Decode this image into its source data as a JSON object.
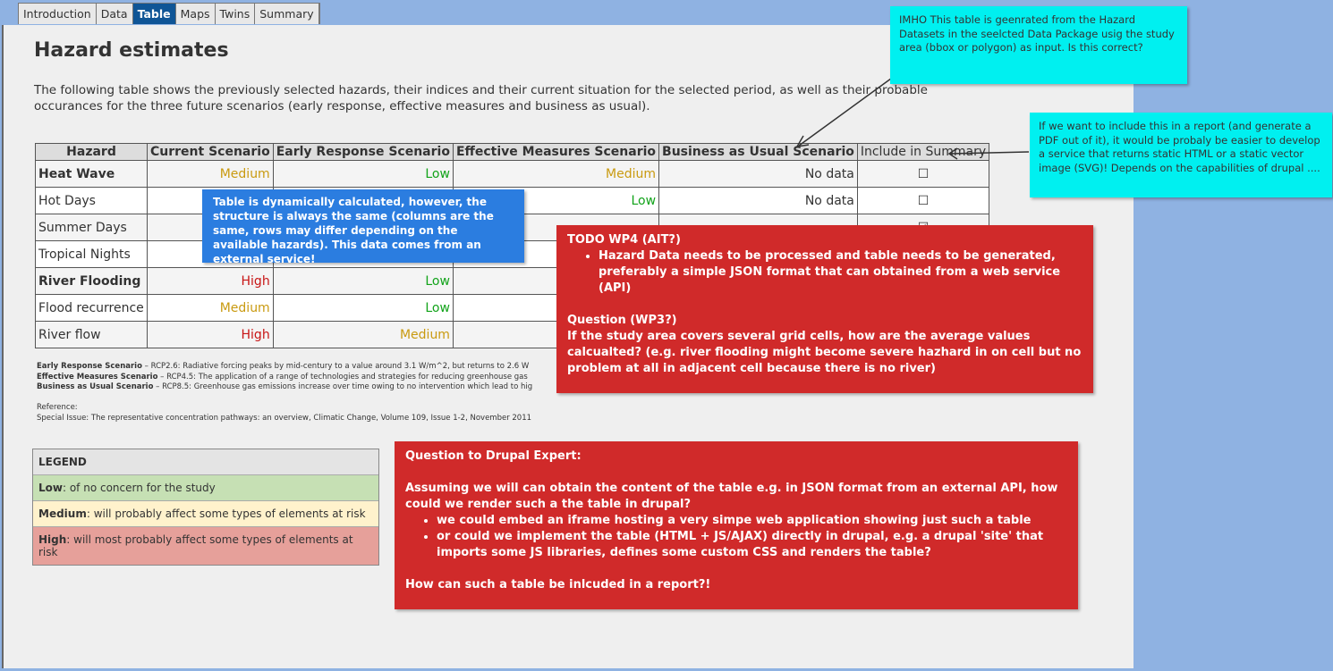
{
  "tabs": [
    "Introduction",
    "Data",
    "Table",
    "Maps",
    "Twins",
    "Summary"
  ],
  "active_tab": "Table",
  "title": "Hazard estimates",
  "intro": "The following table shows the previously selected hazards, their indices and their current situation for the selected period, as well as their probable occurances for the three future scenarios (early response, effective measures and business as usual).",
  "table": {
    "headers": [
      "Hazard",
      "Current Scenario",
      "Early Response Scenario",
      "Effective Measures Scenario",
      "Business as Usual Scenario",
      "Include in Summary"
    ],
    "rows": [
      {
        "hazard": "Heat Wave",
        "bold": true,
        "current": "Medium",
        "early": "Low",
        "effective": "Medium",
        "business": "No data",
        "include": false
      },
      {
        "hazard": "Hot Days",
        "bold": false,
        "current": "",
        "early": "",
        "effective": "Low",
        "business": "No data",
        "include": false
      },
      {
        "hazard": "Summer Days",
        "bold": false,
        "current": "",
        "early": "",
        "effective": "",
        "business": "",
        "include": true
      },
      {
        "hazard": "Tropical Nights",
        "bold": false,
        "current": "",
        "early": "",
        "effective": "",
        "business": "",
        "include": false
      },
      {
        "hazard": "River Flooding",
        "bold": true,
        "current": "High",
        "early": "Low",
        "effective": "",
        "business": "",
        "include": false
      },
      {
        "hazard": "Flood recurrence",
        "bold": false,
        "current": "Medium",
        "early": "Low",
        "effective": "",
        "business": "",
        "include": false
      },
      {
        "hazard": "River flow",
        "bold": false,
        "current": "High",
        "early": "Medium",
        "effective": "",
        "business": "",
        "include": false
      }
    ]
  },
  "footnotes": [
    {
      "label": "Early Response Scenario",
      "text": " – RCP2.6: Radiative forcing peaks by mid-century to a value around 3.1 W/m^2, but returns to 2.6 W"
    },
    {
      "label": "Effective Measures Scenario",
      "text": " – RCP4.5: The application of a range of technologies and strategies for reducing greenhouse gas"
    },
    {
      "label": "Business as Usual Scenario",
      "text": " – RCP8.5: Greenhouse gas emissions increase over time owing to no intervention which lead to hig"
    }
  ],
  "reference_label": "Reference:",
  "reference": "Special Issue: The representative concentration pathways: an overview, Climatic Change, Volume 109, Issue 1-2, November 2011",
  "legend": {
    "title": "LEGEND",
    "items": [
      {
        "level": "Low",
        "text": ": of no concern for the study",
        "color": "#c6e0b4"
      },
      {
        "level": "Medium",
        "text": ": will probably affect some types of elements at risk",
        "color": "#fff2cc"
      },
      {
        "level": "High",
        "text": ": will most probably affect some types of elements at risk",
        "color": "#e6a09a"
      }
    ]
  },
  "notes": {
    "cyan1": "IMHO This table is geenrated from the Hazard Datasets in the seelcted Data Package usig the study area (bbox or polygon) as input. Is this correct?",
    "cyan2": "If we want to include this in a report (and generate a PDF out of it), it would be probaly be easier to develop a service that returns static HTML or a static vector image (SVG)! Depends on the capabilities of drupal ....",
    "blue": "Table is dynamically calculated, however, the structure is always the same (columns are the same, rows may differ depending on the available hazards). This data comes from an external service!",
    "todo_title": "TODO WP4 (AIT?)",
    "todo_item": "Hazard Data needs to be processed and table needs to be generated, preferably a simple JSON format that can obtained from a web service (API)",
    "q_title": "Question (WP3?)",
    "q_text": "If the study area covers several grid cells, how are the average values calcualted? (e.g. river flooding might become severe hazhard in on cell but no problem at all in adjacent cell because there is no river)",
    "drupal_title": "Question to Drupal Expert:",
    "drupal_text": "Assuming we will can obtain the content of the table e.g. in JSON format from an external API, how could we render such a the table in drupal?",
    "drupal_items": [
      "we could embed an iframe hosting a very simpe web application showing just such a table",
      "or could we implement the table (HTML + JS/AJAX) directly in drupal, e.g. a drupal 'site' that imports some JS libraries, defines some custom CSS and renders the table?"
    ],
    "drupal_end": "How can such a table be inlcuded in a report?!"
  }
}
